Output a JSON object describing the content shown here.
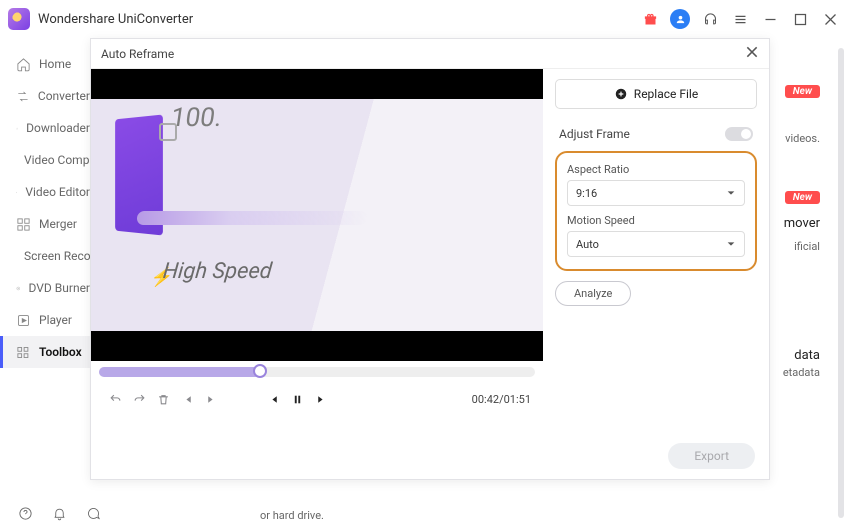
{
  "app": {
    "title": "Wondershare UniConverter"
  },
  "sidebar": {
    "items": [
      {
        "label": "Home"
      },
      {
        "label": "Converter"
      },
      {
        "label": "Downloader"
      },
      {
        "label": "Video Compressor"
      },
      {
        "label": "Video Editor"
      },
      {
        "label": "Merger"
      },
      {
        "label": "Screen Recorder"
      },
      {
        "label": "DVD Burner"
      },
      {
        "label": "Player"
      },
      {
        "label": "Toolbox"
      }
    ]
  },
  "bg": {
    "new": "New",
    "videos": "videos.",
    "mover": "mover",
    "ificial": "ificial",
    "data": "data",
    "etadata": "etadata",
    "bottom_text": "or hard drive."
  },
  "dialog": {
    "title": "Auto Reframe",
    "replace_label": "Replace File",
    "adjust_label": "Adjust Frame",
    "aspect_label": "Aspect Ratio",
    "aspect_value": "9:16",
    "motion_label": "Motion Speed",
    "motion_value": "Auto",
    "analyze": "Analyze",
    "export": "Export",
    "time": "00:42/01:51",
    "preview_text1": "100.",
    "preview_text2": "High Speed"
  }
}
